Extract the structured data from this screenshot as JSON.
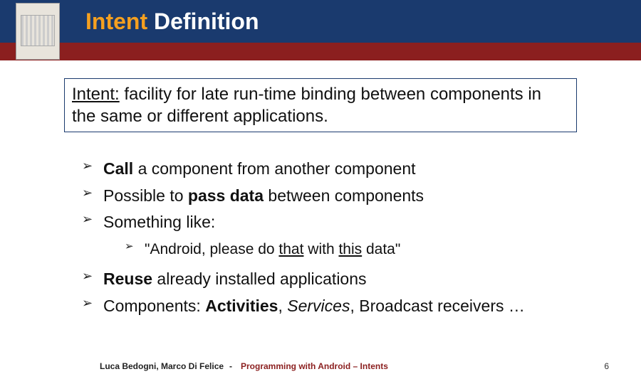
{
  "header": {
    "title_accent": "Intent",
    "title_rest": " Definition"
  },
  "definition": {
    "lead": "Intent:",
    "text": " facility for late run-time binding between components in the same or different applications."
  },
  "bullets": {
    "b1_bold": "Call",
    "b1_rest": " a component from another component",
    "b2_pre": "Possible to ",
    "b2_bold": "pass data",
    "b2_rest": " between components",
    "b3": "Something like:",
    "sub_pre": "\"Android, please do ",
    "sub_u1": "that",
    "sub_mid": " with ",
    "sub_u2": "this",
    "sub_post": " data\"",
    "b4_bold": "Reuse",
    "b4_rest": " already installed applications",
    "b5_pre": "Components: ",
    "b5_bold": "Activities",
    "b5_mid": ", ",
    "b5_italic": "Services",
    "b5_rest": ", Broadcast receivers …"
  },
  "footer": {
    "authors": "Luca Bedogni, Marco Di Felice",
    "sep": "-",
    "topic": "Programming with Android – Intents",
    "page": "6"
  }
}
